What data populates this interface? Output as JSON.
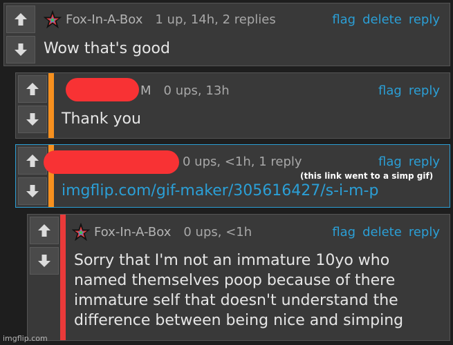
{
  "comments": [
    {
      "author": "Fox-In-A-Box",
      "meta": "1 up, 14h, 2 replies",
      "actions": [
        "flag",
        "delete",
        "reply"
      ],
      "text": "Wow that's good"
    },
    {
      "author": "M",
      "meta": "0 ups, 13h",
      "actions": [
        "flag",
        "reply"
      ],
      "text": "Thank you",
      "bar_color": "#f7901e"
    },
    {
      "meta": "0 ups, <1h, 1 reply",
      "actions": [
        "flag",
        "reply"
      ],
      "link": "imgflip.com/gif-maker/305616427/s-i-m-p",
      "bar_color": "#f7901e"
    },
    {
      "author": "Fox-In-A-Box",
      "meta": "0 ups, <1h",
      "actions": [
        "flag",
        "delete",
        "reply"
      ],
      "text": "Sorry that I'm not an immature 10yo who named themselves poop because of there immature self that doesn't understand the difference between being nice and simping",
      "bar_color": "#ea3a3a"
    }
  ],
  "annotation": "(this link went to a simp gif)",
  "watermark": "imgflip.com",
  "icons": {
    "upvote": "arrow-up-icon",
    "downvote": "arrow-down-icon",
    "avatar": "rainbow-star-icon"
  },
  "colors": {
    "background": "#1e1e1e",
    "panel": "#393939",
    "accent_link": "#2b9fd6",
    "redaction": "#f83234"
  }
}
